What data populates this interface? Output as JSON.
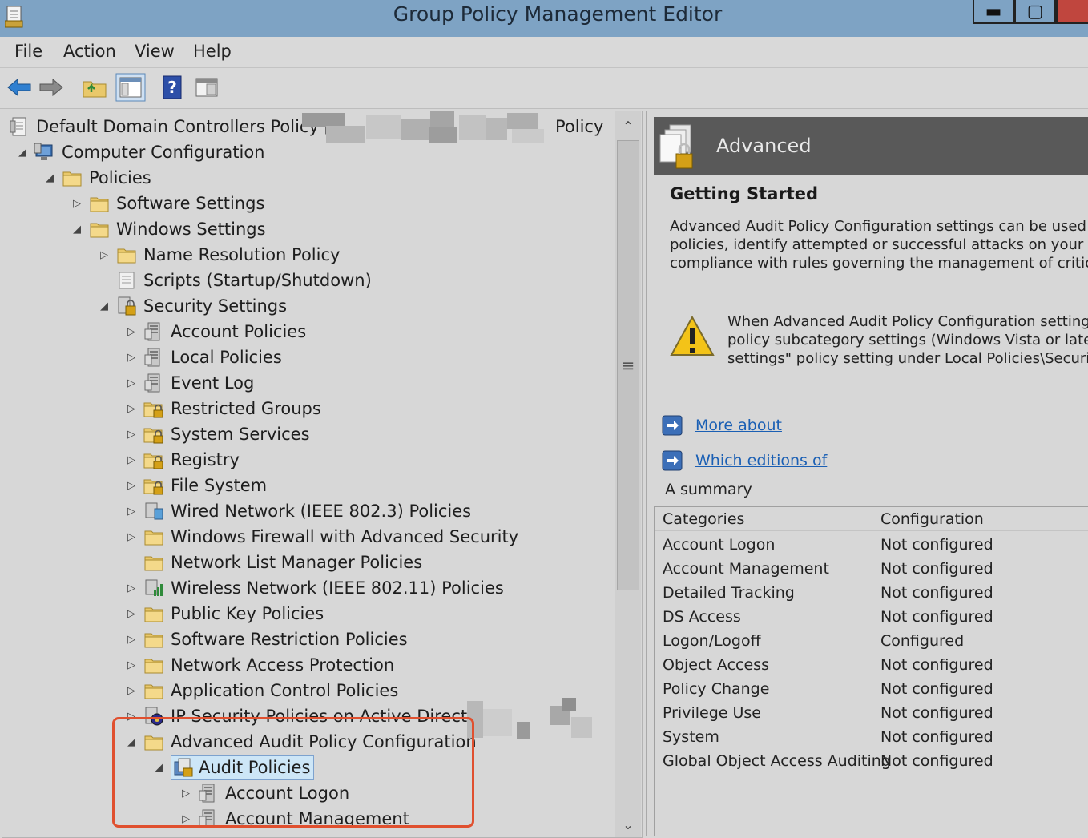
{
  "window": {
    "title": "Group Policy Management Editor",
    "minimize": "▬",
    "maximize": "▢",
    "close": ""
  },
  "menu": [
    "File",
    "Action",
    "View",
    "Help"
  ],
  "tree": {
    "root_label": "Default Domain Controllers Policy [",
    "root_suffix": "Policy",
    "computer_configuration": "Computer Configuration",
    "policies": "Policies",
    "software_settings": "Software Settings",
    "windows_settings": "Windows Settings",
    "name_resolution_policy": "Name Resolution Policy",
    "scripts": "Scripts (Startup/Shutdown)",
    "security_settings": "Security Settings",
    "account_policies": "Account Policies",
    "local_policies": "Local Policies",
    "event_log": "Event Log",
    "restricted_groups": "Restricted Groups",
    "system_services": "System Services",
    "registry": "Registry",
    "file_system": "File System",
    "wired_network": "Wired Network (IEEE 802.3) Policies",
    "windows_firewall": "Windows Firewall with Advanced Security",
    "network_list_manager": "Network List Manager Policies",
    "wireless_network": "Wireless Network (IEEE 802.11) Policies",
    "public_key": "Public Key Policies",
    "software_restriction": "Software Restriction Policies",
    "network_access_protection": "Network Access Protection",
    "application_control": "Application Control Policies",
    "ip_security": "IP Security Policies on Active Directory",
    "advanced_audit": "Advanced Audit Policy Configuration",
    "audit_policies": "Audit Policies",
    "account_logon": "Account Logon",
    "account_management": "Account Management"
  },
  "details": {
    "header": "Advanced",
    "heading": "Getting Started",
    "para1": [
      "Advanced Audit Policy Configuration settings can be used to pr",
      "policies, identify attempted or successful attacks on your netwo",
      "compliance with rules governing the management of critical org"
    ],
    "warning": [
      "When Advanced Audit Policy Configuration settings ar",
      "policy subcategory settings (Windows Vista or later) to",
      "settings\" policy setting under Local Policies\\Security O"
    ],
    "link1": "More about ",
    "link2": "Which editions of ",
    "summary": "A summary",
    "table": {
      "headers": [
        "Categories",
        "Configuration"
      ],
      "rows": [
        [
          "Account Logon",
          "Not configured"
        ],
        [
          "Account Management",
          "Not configured"
        ],
        [
          "Detailed Tracking",
          "Not configured"
        ],
        [
          "DS Access",
          "Not configured"
        ],
        [
          "Logon/Logoff",
          "Configured"
        ],
        [
          "Object Access",
          "Not configured"
        ],
        [
          "Policy Change",
          "Not configured"
        ],
        [
          "Privilege Use",
          "Not configured"
        ],
        [
          "System",
          "Not configured"
        ],
        [
          "Global Object Access Auditing",
          "Not configured"
        ]
      ]
    }
  },
  "scrollbar": {
    "up": "⌃",
    "down": "⌄",
    "grip": "≡"
  }
}
